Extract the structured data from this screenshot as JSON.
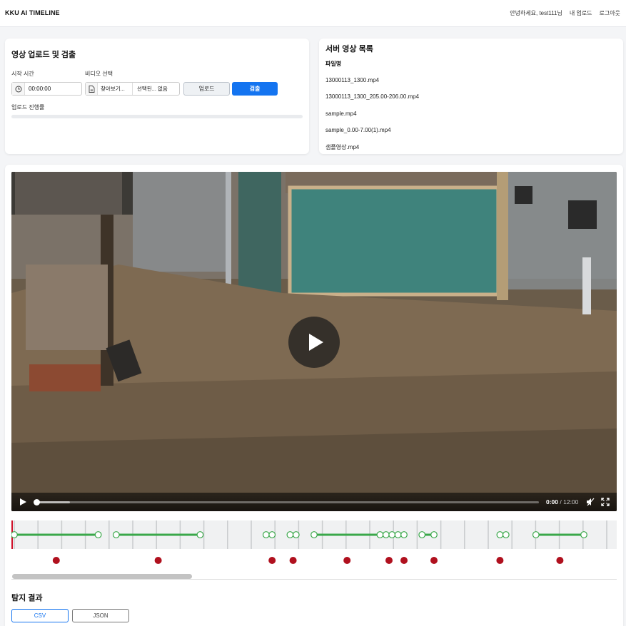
{
  "header": {
    "brand": "KKU AI TIMELINE",
    "greeting": "안녕하세요, test111님",
    "my_uploads": "내 업로드",
    "logout": "로그아웃"
  },
  "upload": {
    "title": "영상 업로드 및 검출",
    "start_time_label": "시작 시간",
    "start_time_value": "00:00:00",
    "video_select_label": "비디오 선택",
    "browse_label": "찾아보기...",
    "no_file_label": "선택된... 없음",
    "upload_button": "업로드",
    "detect_button": "검출",
    "progress_label": "업로드 진행률",
    "progress": 0
  },
  "server_list": {
    "title": "서버 영상 목록",
    "column_header": "파일명",
    "files": [
      "13000113_1300.mp4",
      "13000113_1300_205.00-206.00.mp4",
      "sample.mp4",
      "sample_0.00-7.00(1).mp4",
      "샘플영상.mp4"
    ]
  },
  "player": {
    "current_time": "0:00",
    "separator": " / ",
    "duration": "12:00",
    "play_icon": "play-icon",
    "mute_icon": "muted-speaker-icon",
    "fullscreen_icon": "fullscreen-icon"
  },
  "timeline": {
    "accent": "#3aa84a",
    "marker_color": "#b0101e",
    "segments": [
      {
        "start": 0,
        "end": 14
      },
      {
        "start": 17,
        "end": 31
      },
      {
        "start": 42,
        "end": 43
      },
      {
        "start": 46,
        "end": 47
      },
      {
        "start": 50,
        "end": 61
      },
      {
        "start": 62,
        "end": 63
      },
      {
        "start": 64,
        "end": 65
      },
      {
        "start": 68,
        "end": 70
      },
      {
        "start": 81,
        "end": 82
      },
      {
        "start": 87,
        "end": 95
      }
    ],
    "markers": [
      7,
      24,
      43,
      46.5,
      55.5,
      62.5,
      65,
      70,
      81,
      91
    ]
  },
  "results": {
    "title": "탐지 결과",
    "csv_button": "CSV",
    "json_button": "JSON"
  }
}
